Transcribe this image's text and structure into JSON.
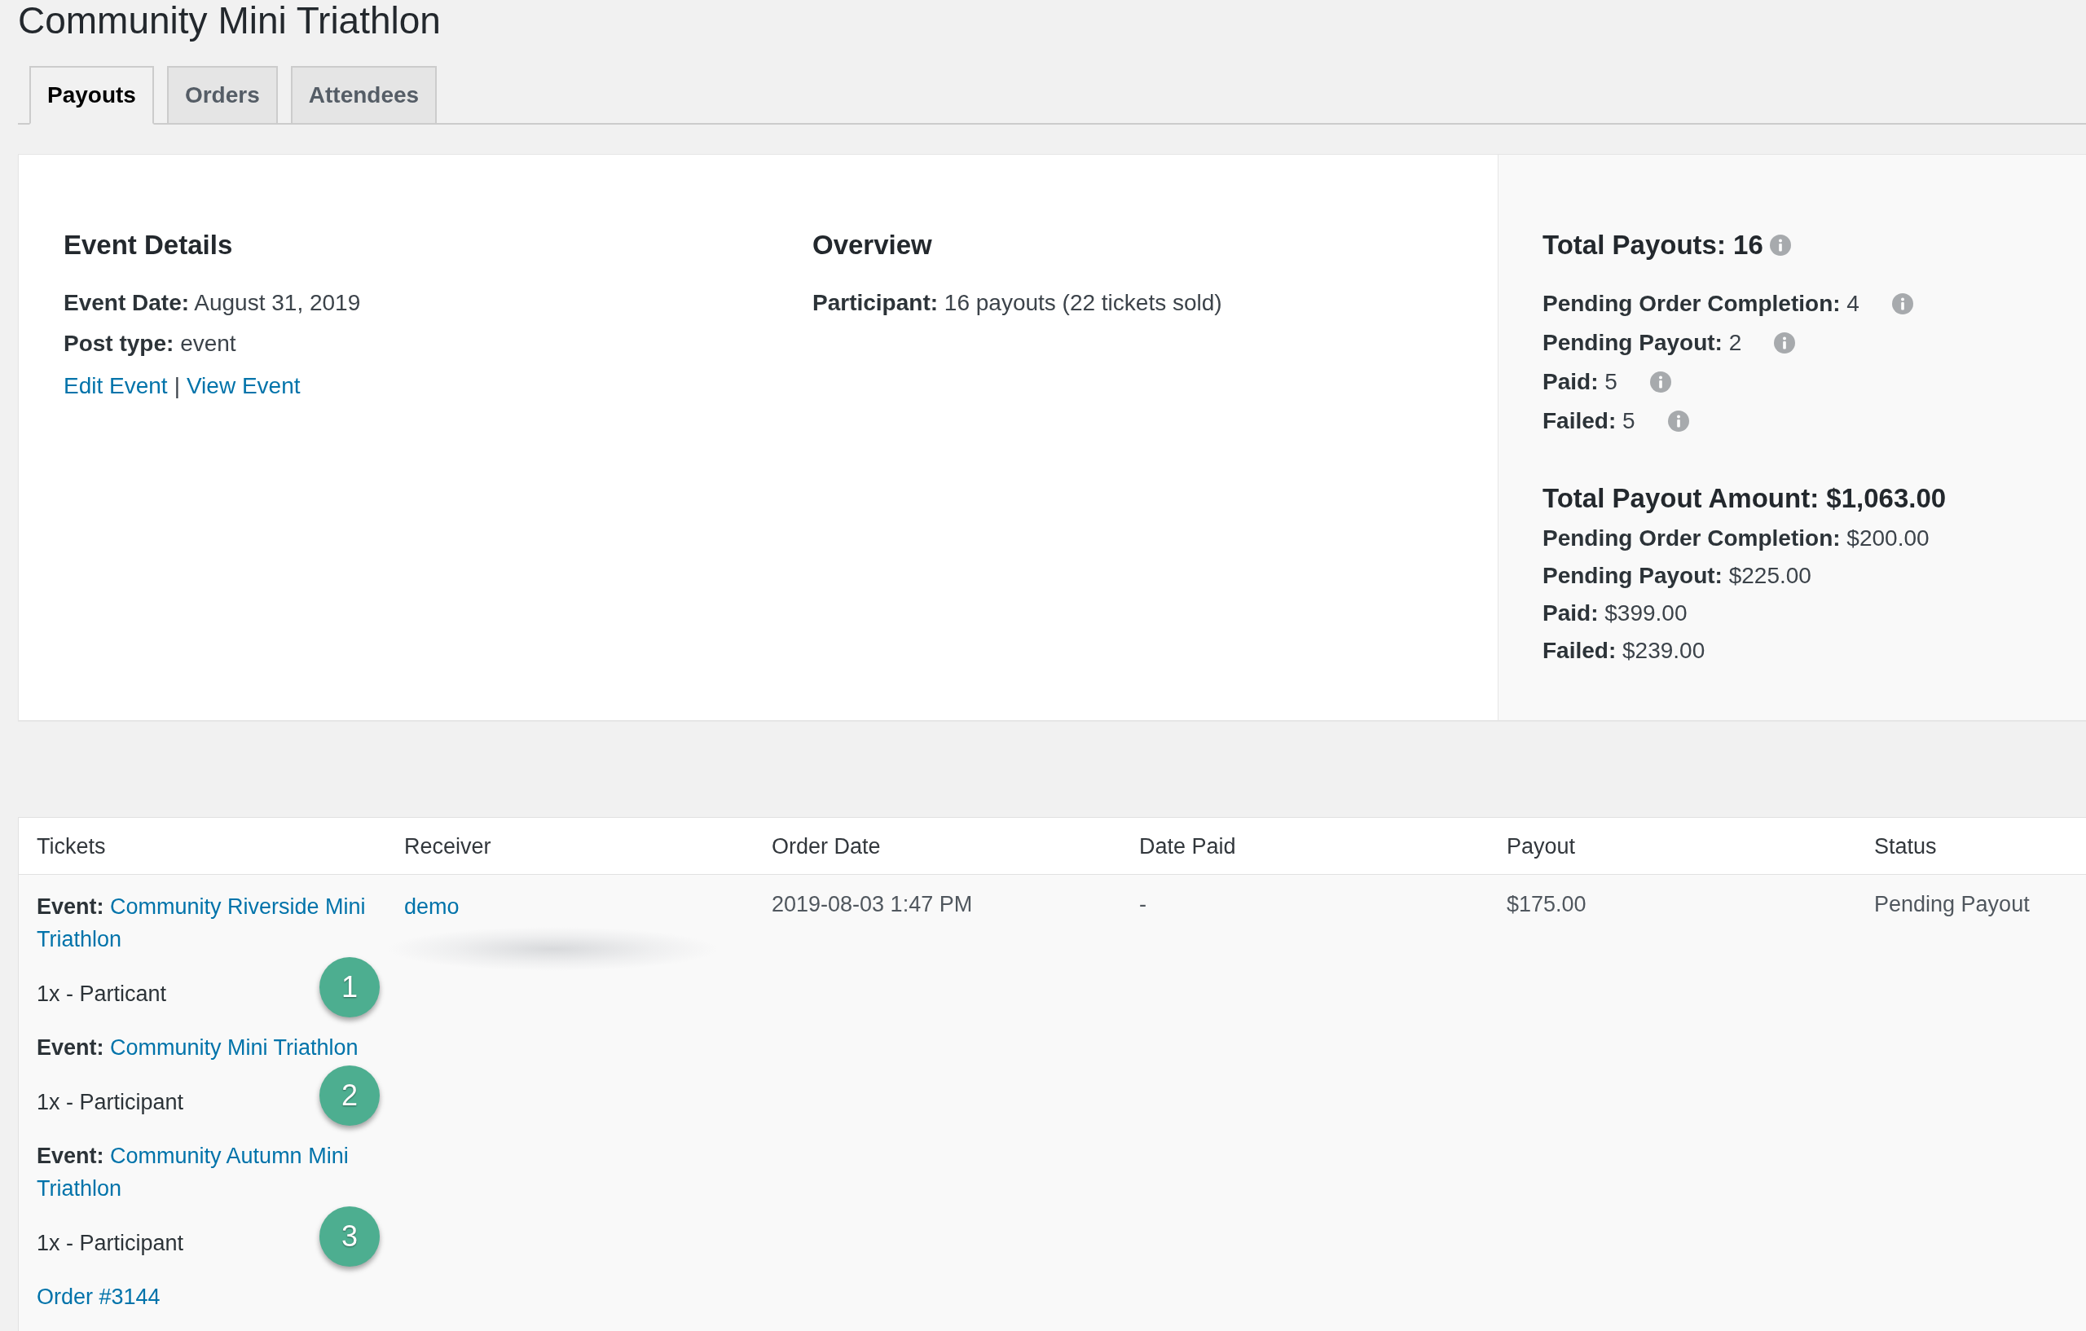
{
  "page_title": "Community Mini Triathlon",
  "tabs": [
    {
      "label": "Payouts",
      "selected": true
    },
    {
      "label": "Orders",
      "selected": false
    },
    {
      "label": "Attendees",
      "selected": false
    }
  ],
  "event_details": {
    "heading": "Event Details",
    "lines": [
      "**Event Date:** August 31, 2019",
      "**Post type:** event"
    ],
    "links": [
      "Edit Event",
      "View Event"
    ],
    "separator": "|"
  },
  "overview": {
    "heading": "Overview",
    "lines": [
      "**Participant:** 16 payouts (22 tickets sold)"
    ]
  },
  "summary": {
    "payouts_heading": "Total Payouts: 16",
    "payout_counts": [
      "**Pending Order Completion:** 4",
      "**Pending Payout:** 2",
      "**Paid:** 5",
      "**Failed:** 5"
    ],
    "amount_heading": "Total Payout Amount: $1,063.00",
    "payout_amounts": [
      "**Pending Order Completion:** $200.00",
      "**Pending Payout:** $225.00",
      "**Paid:** $399.00",
      "**Failed:** $239.00"
    ]
  },
  "table": {
    "columns": [
      "Tickets",
      "Receiver",
      "Order Date",
      "Date Paid",
      "Payout",
      "Status"
    ],
    "rows": [
      {
        "tickets": [
          {
            "label": "Event:",
            "event": "Community Riverside Mini Triathlon",
            "quantity": "1x - Particant",
            "marker": "1"
          },
          {
            "label": "Event:",
            "event": "Community Mini Triathlon",
            "quantity": "1x - Participant",
            "marker": "2"
          },
          {
            "label": "Event:",
            "event": "Community Autumn Mini Triathlon",
            "quantity": "1x - Participant",
            "marker": "3"
          }
        ],
        "order_link": "Order #3144",
        "receiver": "demo",
        "order_date": "2019-08-03 1:47 PM",
        "date_paid": "-",
        "payout": "$175.00",
        "status": "Pending Payout"
      }
    ]
  }
}
